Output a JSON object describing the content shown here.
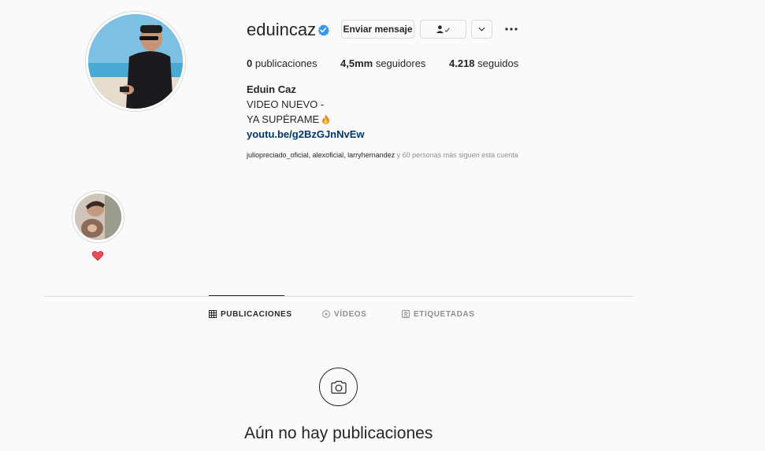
{
  "profile": {
    "username": "eduincaz",
    "verified": true,
    "buttons": {
      "message": "Enviar mensaje",
      "follow_icon": "person-check-icon",
      "dropdown_icon": "chevron-down-icon",
      "more_icon": "more-options-icon"
    },
    "stats": {
      "posts_count": "0",
      "posts_label": "publicaciones",
      "followers_count": "4,5mm",
      "followers_label": "seguidores",
      "following_count": "4.218",
      "following_label": "seguidos"
    },
    "bio": {
      "name": "Eduin Caz",
      "line1": "VIDEO NUEVO -",
      "line2": "YA SUPÉRAME",
      "emoji": "fire-icon",
      "link": "youtu.be/g2BzGJnNvEw"
    },
    "followed_by": {
      "names": "juliopreciado_oficial, alexoficial, larryhernandez",
      "suffix": " y 60 personas más siguen esta cuenta"
    }
  },
  "highlights": [
    {
      "label_icon": "heart-icon"
    }
  ],
  "tabs": [
    {
      "label": "PUBLICACIONES",
      "icon": "grid-icon",
      "active": true
    },
    {
      "label": "VÍDEOS",
      "icon": "play-icon",
      "active": false
    },
    {
      "label": "ETIQUETADAS",
      "icon": "tag-icon",
      "active": false
    }
  ],
  "empty_state": {
    "icon": "camera-icon",
    "text": "Aún no hay publicaciones"
  },
  "colors": {
    "background": "#fafafa",
    "text": "#262626",
    "muted": "#8e8e8e",
    "border": "#dbdbdb",
    "link": "#00376b",
    "verified": "#3897f0",
    "heart": "#ed4956"
  }
}
